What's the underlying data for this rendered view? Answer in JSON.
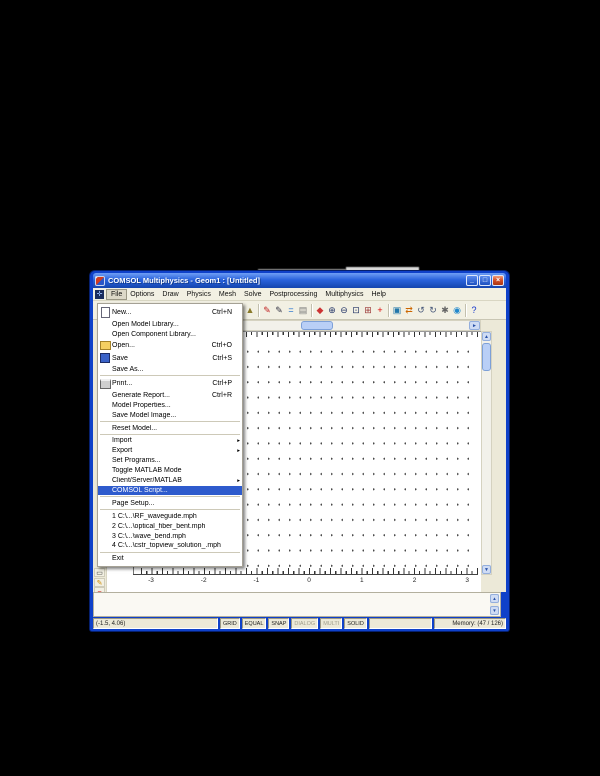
{
  "window": {
    "title": "COMSOL Multiphysics - Geom1 : [Untitled]",
    "controls": {
      "minimize": "_",
      "maximize": "□",
      "close": "×"
    }
  },
  "menu_bar": {
    "window_icon_glyph": "✛",
    "items": [
      {
        "label": "File",
        "open": true
      },
      {
        "label": "Options",
        "open": false
      },
      {
        "label": "Draw",
        "open": false
      },
      {
        "label": "Physics",
        "open": false
      },
      {
        "label": "Mesh",
        "open": false
      },
      {
        "label": "Solve",
        "open": false
      },
      {
        "label": "Postprocessing",
        "open": false
      },
      {
        "label": "Multiphysics",
        "open": false
      },
      {
        "label": "Help",
        "open": false
      }
    ]
  },
  "toolbar": {
    "icons": [
      {
        "name": "model-navigator-icon",
        "glyph": "▲",
        "color": "#8a7a2a",
        "sep": false
      },
      {
        "name": "draw-mode-icon",
        "glyph": "✎",
        "color": "#c02020",
        "sep": true
      },
      {
        "name": "physics-mode-icon",
        "glyph": "✎",
        "color": "#333344",
        "sep": false
      },
      {
        "name": "equation-system-icon",
        "glyph": "=",
        "color": "#1166cc",
        "sep": false
      },
      {
        "name": "mesh-mode-icon",
        "glyph": "▤",
        "color": "#777777",
        "sep": false
      },
      {
        "name": "plot-parameters-icon",
        "glyph": "◆",
        "color": "#cc3333",
        "sep": true
      },
      {
        "name": "zoom-in-icon",
        "glyph": "⊕",
        "color": "#223366",
        "sep": false
      },
      {
        "name": "zoom-out-icon",
        "glyph": "⊖",
        "color": "#223366",
        "sep": false
      },
      {
        "name": "zoom-window-icon",
        "glyph": "⊡",
        "color": "#223366",
        "sep": false
      },
      {
        "name": "zoom-extents-icon",
        "glyph": "⊞",
        "color": "#993333",
        "sep": false
      },
      {
        "name": "draw-point-icon",
        "glyph": "+",
        "color": "#dd0000",
        "sep": false
      },
      {
        "name": "select-objects-icon",
        "glyph": "▣",
        "color": "#2277aa",
        "sep": true
      },
      {
        "name": "pan-icon",
        "glyph": "⇄",
        "color": "#cc6600",
        "sep": false
      },
      {
        "name": "rotate-ccw-icon",
        "glyph": "↺",
        "color": "#445577",
        "sep": false
      },
      {
        "name": "rotate-cw-icon",
        "glyph": "↻",
        "color": "#445577",
        "sep": false
      },
      {
        "name": "settings-icon",
        "glyph": "✱",
        "color": "#666666",
        "sep": false
      },
      {
        "name": "scene-light-icon",
        "glyph": "◉",
        "color": "#2288cc",
        "sep": false
      },
      {
        "name": "help-icon",
        "glyph": "?",
        "color": "#1133cc",
        "sep": true
      }
    ]
  },
  "file_menu": {
    "items": [
      {
        "type": "item",
        "label": "New...",
        "shortcut": "Ctrl+N",
        "icon": "new-document-icon",
        "icon_class": "ic-new"
      },
      {
        "type": "item",
        "label": "Open Model Library..."
      },
      {
        "type": "item",
        "label": "Open Component Library..."
      },
      {
        "type": "item",
        "label": "Open...",
        "shortcut": "Ctrl+O",
        "icon": "open-folder-icon",
        "icon_class": "ic-open"
      },
      {
        "type": "item",
        "label": "Save",
        "shortcut": "Ctrl+S",
        "icon": "save-floppy-icon",
        "icon_class": "ic-save"
      },
      {
        "type": "item",
        "label": "Save As..."
      },
      {
        "type": "separator"
      },
      {
        "type": "item",
        "label": "Print...",
        "shortcut": "Ctrl+P",
        "icon": "printer-icon",
        "icon_class": "ic-print"
      },
      {
        "type": "item",
        "label": "Generate Report...",
        "shortcut": "Ctrl+R"
      },
      {
        "type": "item",
        "label": "Model Properties..."
      },
      {
        "type": "item",
        "label": "Save Model Image..."
      },
      {
        "type": "separator"
      },
      {
        "type": "item",
        "label": "Reset Model..."
      },
      {
        "type": "separator"
      },
      {
        "type": "item",
        "label": "Import",
        "submenu": true
      },
      {
        "type": "item",
        "label": "Export",
        "submenu": true
      },
      {
        "type": "item",
        "label": "Set Programs..."
      },
      {
        "type": "item",
        "label": "Toggle MATLAB Mode"
      },
      {
        "type": "item",
        "label": "Client/Server/MATLAB",
        "submenu": true
      },
      {
        "type": "item",
        "label": "COMSOL Script...",
        "highlighted": true
      },
      {
        "type": "separator"
      },
      {
        "type": "item",
        "label": "Page Setup..."
      },
      {
        "type": "separator"
      },
      {
        "type": "item",
        "label": "1 C:\\...\\RF_waveguide.mph"
      },
      {
        "type": "item",
        "label": "2 C:\\...\\optical_fiber_bent.mph"
      },
      {
        "type": "item",
        "label": "3 C:\\...\\wave_bend.mph"
      },
      {
        "type": "item",
        "label": "4 C:\\...\\cstr_topview_solution_.mph"
      },
      {
        "type": "separator"
      },
      {
        "type": "item",
        "label": "Exit"
      }
    ]
  },
  "side_toolbar": {
    "icons": [
      {
        "name": "draw-rectangle-icon",
        "glyph": "▭",
        "color": "#333333"
      },
      {
        "name": "draw-line-icon",
        "glyph": "✎",
        "color": "#cc8800"
      },
      {
        "name": "draw-curve-icon",
        "glyph": "~",
        "color": "#cc0000"
      }
    ]
  },
  "canvas": {
    "x_axis_labels": [
      "-3",
      "-2",
      "-1",
      "0",
      "1",
      "2",
      "3"
    ]
  },
  "scrollbar_glyphs": {
    "up": "▲",
    "down": "▼",
    "left": "◄",
    "right": "►"
  },
  "status_bar": {
    "coordinates": "(-1.5, 4.06)",
    "toggles": [
      {
        "label": "GRID",
        "active": true
      },
      {
        "label": "EQUAL",
        "active": true
      },
      {
        "label": "SNAP",
        "active": true
      },
      {
        "label": "DIALOG",
        "active": false
      },
      {
        "label": "MULTI",
        "active": false
      },
      {
        "label": "SOLID",
        "active": true
      }
    ],
    "memory": "Memory: (47 / 126)"
  }
}
